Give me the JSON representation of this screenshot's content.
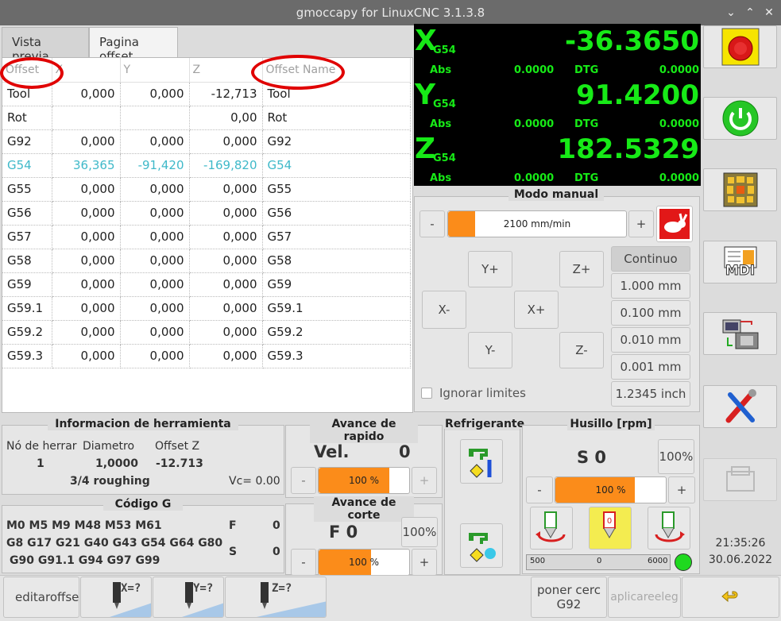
{
  "window": {
    "title": "gmoccapy for LinuxCNC  3.1.3.8"
  },
  "tabs": [
    {
      "label": "Vista previa"
    },
    {
      "label": "Pagina offset"
    }
  ],
  "offset_table": {
    "headers": [
      "Offset",
      "X",
      "Y",
      "Z",
      "Offset Name"
    ],
    "rows": [
      {
        "offset": "Tool",
        "x": "0,000",
        "y": "0,000",
        "z": "-12,713",
        "name": "Tool"
      },
      {
        "offset": "Rot",
        "x": "",
        "y": "",
        "z": "0,00",
        "name": "Rot"
      },
      {
        "offset": "G92",
        "x": "0,000",
        "y": "0,000",
        "z": "0,000",
        "name": "G92"
      },
      {
        "offset": "G54",
        "x": "36,365",
        "y": "-91,420",
        "z": "-169,820",
        "name": "G54"
      },
      {
        "offset": "G55",
        "x": "0,000",
        "y": "0,000",
        "z": "0,000",
        "name": "G55"
      },
      {
        "offset": "G56",
        "x": "0,000",
        "y": "0,000",
        "z": "0,000",
        "name": "G56"
      },
      {
        "offset": "G57",
        "x": "0,000",
        "y": "0,000",
        "z": "0,000",
        "name": "G57"
      },
      {
        "offset": "G58",
        "x": "0,000",
        "y": "0,000",
        "z": "0,000",
        "name": "G58"
      },
      {
        "offset": "G59",
        "x": "0,000",
        "y": "0,000",
        "z": "0,000",
        "name": "G59"
      },
      {
        "offset": "G59.1",
        "x": "0,000",
        "y": "0,000",
        "z": "0,000",
        "name": "G59.1"
      },
      {
        "offset": "G59.2",
        "x": "0,000",
        "y": "0,000",
        "z": "0,000",
        "name": "G59.2"
      },
      {
        "offset": "G59.3",
        "x": "0,000",
        "y": "0,000",
        "z": "0,000",
        "name": "G59.3"
      }
    ]
  },
  "dro": {
    "x": {
      "letter": "X",
      "sys": "G54",
      "value": "-36.3650",
      "abs_label": "Abs",
      "abs": "0.0000",
      "dtg_label": "DTG",
      "dtg": "0.0000"
    },
    "y": {
      "letter": "Y",
      "sys": "G54",
      "value": "91.4200",
      "abs_label": "Abs",
      "abs": "0.0000",
      "dtg_label": "DTG",
      "dtg": "0.0000"
    },
    "z": {
      "letter": "Z",
      "sys": "G54",
      "value": "182.5329",
      "abs_label": "Abs",
      "abs": "0.0000",
      "dtg_label": "DTG",
      "dtg": "0.0000"
    }
  },
  "manual": {
    "title": "Modo manual",
    "minus": "-",
    "plus": "+",
    "jog_velocity": "2100 mm/min",
    "jog_fill": 0.15,
    "jog_buttons": {
      "yplus": "Y+",
      "zplus": "Z+",
      "xminus": "X-",
      "xplus": "X+",
      "yminus": "Y-",
      "zminus": "Z-"
    },
    "increments": [
      "Continuo",
      "1.000 mm",
      "0.100 mm",
      "0.010 mm",
      "0.001 mm",
      "1.2345 inch"
    ],
    "ignore_limits": "Ignorar limites"
  },
  "sidebar": {
    "mdi_label": "MDI"
  },
  "tool_info": {
    "title": "Informacion de herramienta",
    "col_tool": "Nó de herrar",
    "col_diam": "Diametro",
    "col_offz": "Offset Z",
    "tool": "1",
    "diameter": "1,0000",
    "offset_z": "-12.713",
    "description": "3/4 roughing",
    "vc": "Vc= 0.00"
  },
  "gcode": {
    "title": "Código G",
    "line1": "M0 M5 M9 M48 M53 M61",
    "line2": "G8 G17 G21 G40 G43 G54 G64 G80",
    "line3": "G90 G91.1 G94 G97 G99",
    "f_label": "F",
    "f_value": "0",
    "s_label": "S",
    "s_value": "0"
  },
  "rapid": {
    "title": "Avance de rapido",
    "vel_label": "Vel.",
    "vel_value": "0",
    "percent": "100 %",
    "fill": 0.78
  },
  "feed": {
    "title": "Avance de corte",
    "label": "F  0",
    "reset": "100%",
    "percent": "100 %",
    "fill": 0.58
  },
  "coolant": {
    "title": "Refrigerante"
  },
  "spindle": {
    "title": "Husillo [rpm]",
    "speed": "S 0",
    "reset": "100%",
    "percent": "100 %",
    "fill": 0.72,
    "scale_min": "500",
    "scale_mid": "0",
    "scale_max": "6000",
    "led_color": "#1fd91f"
  },
  "clock": {
    "time": "21:35:26",
    "date": "30.06.2022"
  },
  "bottom": {
    "edit_offsets": "editaroffset",
    "x_touch": "X=?",
    "y_touch": "Y=?",
    "z_touch": "Z=?",
    "zero_label": "poner cerc",
    "zero_sub": "G92",
    "apply": "aplicareeleg"
  },
  "colors": {
    "accent_orange": "#fb8c1a",
    "dro_green": "#17ea17",
    "active_row": "#3fb9c9",
    "highlight_oval": "#e00000"
  }
}
